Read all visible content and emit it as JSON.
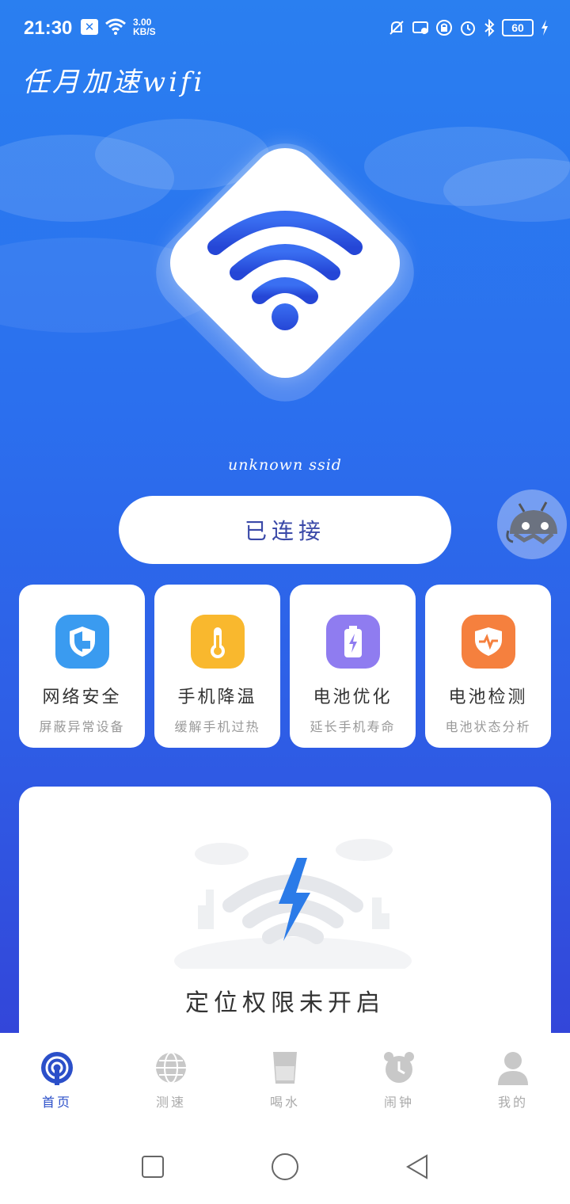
{
  "status_bar": {
    "time": "21:30",
    "speed_value": "3.00",
    "speed_unit": "KB/S",
    "battery": "60"
  },
  "app": {
    "title": "任月加速wifi"
  },
  "network": {
    "ssid": "unknown ssid",
    "connect_label": "已连接"
  },
  "features": [
    {
      "title": "网络安全",
      "subtitle": "屏蔽异常设备",
      "icon": "shield-icon",
      "color": "#3a9bf0"
    },
    {
      "title": "手机降温",
      "subtitle": "缓解手机过热",
      "icon": "thermometer-icon",
      "color": "#f9b82e"
    },
    {
      "title": "电池优化",
      "subtitle": "延长手机寿命",
      "icon": "battery-icon",
      "color": "#8f7cf0"
    },
    {
      "title": "电池检测",
      "subtitle": "电池状态分析",
      "icon": "heartbeat-shield-icon",
      "color": "#f5803e"
    }
  ],
  "location_card": {
    "message": "定位权限未开启"
  },
  "tabs": [
    {
      "label": "首页",
      "icon": "home-wifi-icon",
      "active": true
    },
    {
      "label": "测速",
      "icon": "globe-icon",
      "active": false
    },
    {
      "label": "喝水",
      "icon": "water-cup-icon",
      "active": false
    },
    {
      "label": "闹钟",
      "icon": "alarm-clock-icon",
      "active": false
    },
    {
      "label": "我的",
      "icon": "user-icon",
      "active": false
    }
  ],
  "colors": {
    "accent": "#2b4fc9",
    "hero_top": "#2a7ff0",
    "hero_bottom": "#3346d9"
  }
}
